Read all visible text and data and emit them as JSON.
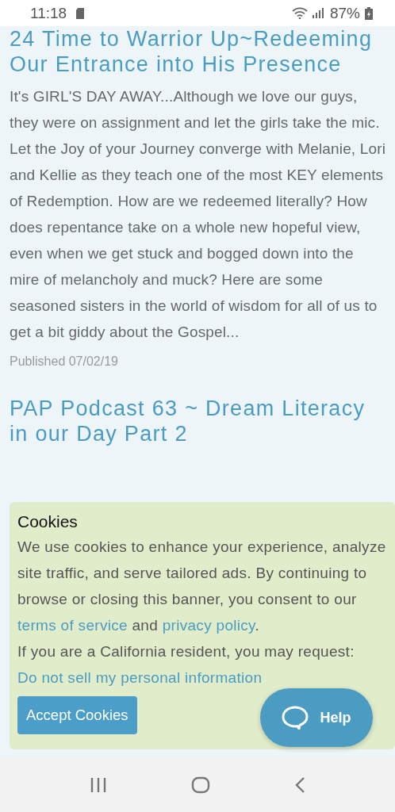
{
  "status_bar": {
    "time": "11:18",
    "battery": "87%"
  },
  "posts": [
    {
      "title": "24 Time to Warrior Up~Redeeming Our Entrance into His Presence",
      "description": "It's GIRL'S DAY AWAY...Although we love our guys, they were on assignment and let the girls take the mic. Let the Joy of your Journey converge with Melanie, Lori and Kellie as they teach one of the most KEY elements of Redemption. How are we redeemed literally? How does repentance take on a whole new hopeful view, even when we get stuck and bogged down into the mire of melancholy and muck? Here are some seasoned sisters in the world of wisdom for all of us to get a bit giddy about the Gospel...",
      "published": "Published 07/02/19"
    },
    {
      "title": "PAP Podcast 63 ~ Dream Literacy in our Day Part 2"
    }
  ],
  "cookie_banner": {
    "title": "Cookies",
    "text_before": "We use cookies to enhance your experience, analyze site traffic, and serve tailored ads. By continuing to browse or closing this banner, you consent to our",
    "terms_link": "terms of service",
    "text_and": "and",
    "privacy_link": "privacy policy",
    "text_after": ".",
    "california_text": "If you are a California resident, you may request:",
    "do_not_sell_link": "Do not sell my personal information",
    "accept_button": "Accept Cookies"
  },
  "help_button": {
    "label": "Help"
  }
}
